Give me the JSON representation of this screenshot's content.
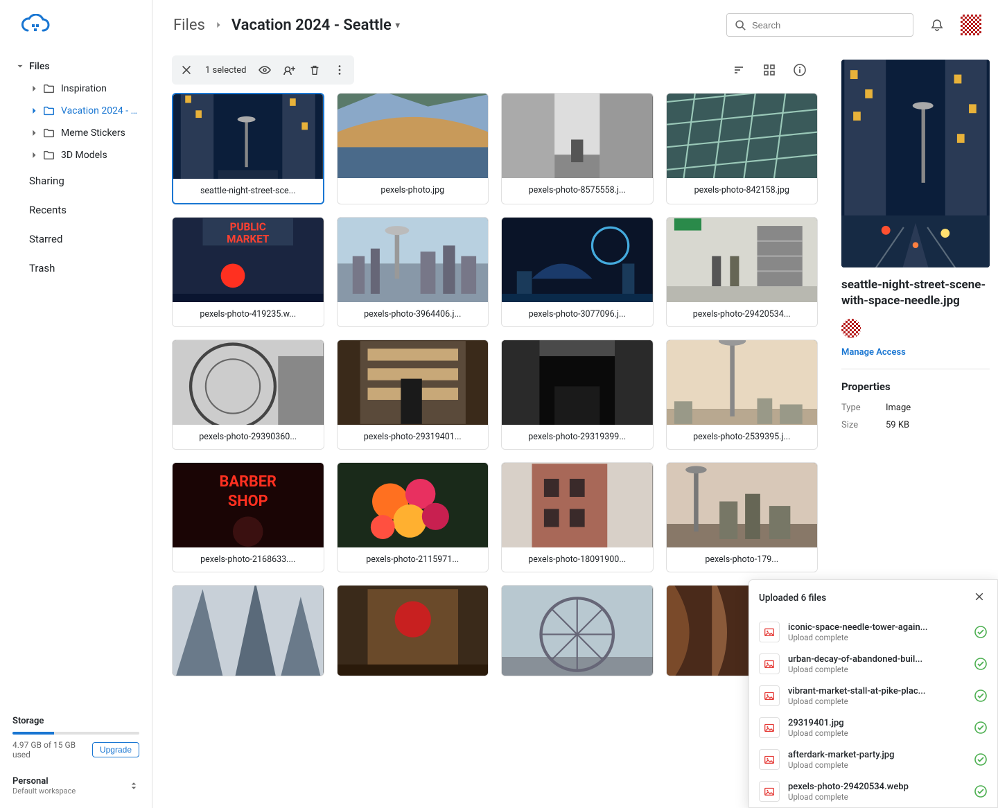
{
  "sidebar": {
    "root_label": "Files",
    "folders": [
      {
        "label": "Inspiration",
        "active": false
      },
      {
        "label": "Vacation 2024 - S...",
        "active": true
      },
      {
        "label": "Meme Stickers",
        "active": false
      },
      {
        "label": "3D Models",
        "active": false
      }
    ],
    "links": [
      "Sharing",
      "Recents",
      "Starred",
      "Trash"
    ]
  },
  "storage": {
    "title": "Storage",
    "text": "4.97 GB of 15 GB used",
    "percent": 33,
    "upgrade": "Upgrade"
  },
  "workspace": {
    "name": "Personal",
    "sub": "Default workspace"
  },
  "breadcrumb": {
    "root": "Files",
    "current": "Vacation 2024 - Seattle"
  },
  "search": {
    "placeholder": "Search"
  },
  "selection": {
    "count_text": "1 selected"
  },
  "thumbs": [
    {
      "name": "seattle-night-street-sce...",
      "selected": true,
      "kind": "night_needle"
    },
    {
      "name": "pexels-photo.jpg",
      "kind": "bridge_water"
    },
    {
      "name": "pexels-photo-8575558.j...",
      "kind": "street_bw"
    },
    {
      "name": "pexels-photo-842158.jpg",
      "kind": "glass_office"
    },
    {
      "name": "pexels-photo-419235.w...",
      "kind": "public_market"
    },
    {
      "name": "pexels-photo-3964406.j...",
      "kind": "skyline_day"
    },
    {
      "name": "pexels-photo-3077096.j...",
      "kind": "skyline_night"
    },
    {
      "name": "pexels-photo-29420534...",
      "kind": "subway"
    },
    {
      "name": "pexels-photo-29390360...",
      "kind": "ferris_bw"
    },
    {
      "name": "pexels-photo-29319401...",
      "kind": "bakery"
    },
    {
      "name": "pexels-photo-29319399...",
      "kind": "alley_dark"
    },
    {
      "name": "pexels-photo-2539395.j...",
      "kind": "needle_sunset"
    },
    {
      "name": "pexels-photo-2168633....",
      "kind": "barber_neon"
    },
    {
      "name": "pexels-photo-2115971...",
      "kind": "flowers"
    },
    {
      "name": "pexels-photo-18091900...",
      "kind": "brick_bldg"
    },
    {
      "name": "pexels-photo-179...",
      "kind": "skyline_needle"
    },
    {
      "name": "",
      "kind": "skyscrapers_up"
    },
    {
      "name": "",
      "kind": "cafe_sign"
    },
    {
      "name": "",
      "kind": "ferris_wheel"
    },
    {
      "name": "",
      "kind": "fabric"
    }
  ],
  "details": {
    "filename": "seattle-night-street-scene-with-space-needle.jpg",
    "manage": "Manage Access",
    "props_title": "Properties",
    "type_label": "Type",
    "type_value": "Image",
    "size_label": "Size",
    "size_value": "59 KB"
  },
  "upload": {
    "title": "Uploaded 6 files",
    "status": "Upload complete",
    "items": [
      "iconic-space-needle-tower-again...",
      "urban-decay-of-abandoned-buil...",
      "vibrant-market-stall-at-pike-plac...",
      "29319401.jpg",
      "afterdark-market-party.jpg",
      "pexels-photo-29420534.webp"
    ]
  }
}
